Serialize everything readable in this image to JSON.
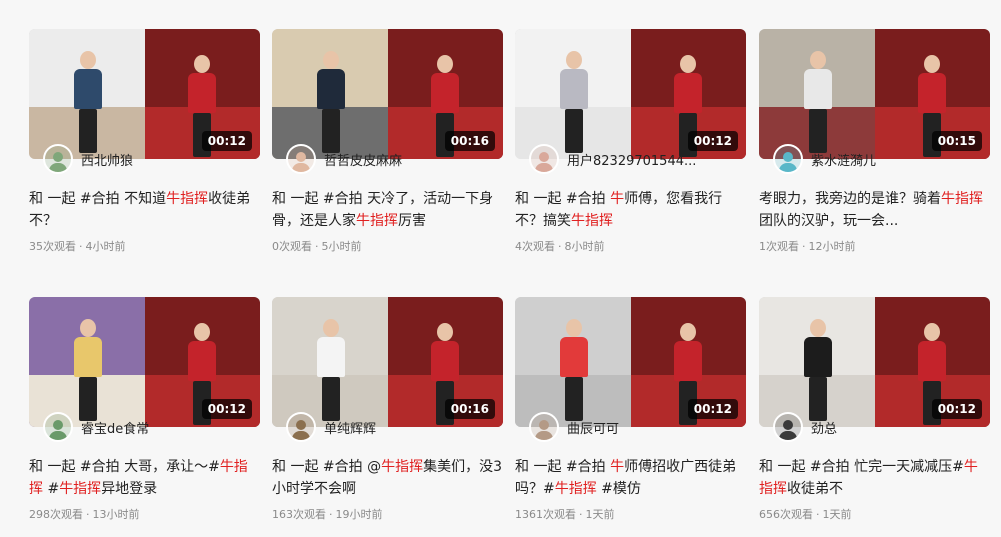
{
  "videos": [
    {
      "duration": "00:12",
      "author": "西北帅狼",
      "title_parts": [
        "和 一起 #合拍 不知道",
        "牛指挥",
        "收徒弟不？"
      ],
      "views": "35次观看",
      "time": "4小时前",
      "colors": {
        "left_bg": "#ececec",
        "left_floor": "#c9b7a2",
        "shirt": "#2e4a6b",
        "avatar": "#7fa77a"
      }
    },
    {
      "duration": "00:16",
      "author": "哲哲皮皮麻麻",
      "title_parts": [
        "和 一起 #合拍 天冷了，活动一下身骨，还是人家",
        "牛指挥",
        "厉害"
      ],
      "views": "0次观看",
      "time": "5小时前",
      "colors": {
        "left_bg": "#d9cbb0",
        "left_floor": "#6e6e6e",
        "shirt": "#1f2a3a",
        "avatar": "#e0b8a0"
      }
    },
    {
      "duration": "00:12",
      "author": "用户82329701544...",
      "title_parts": [
        "和 一起 #合拍 ",
        "牛",
        "师傅，您看我行不？搞笑",
        "牛指挥",
        ""
      ],
      "views": "4次观看",
      "time": "8小时前",
      "colors": {
        "left_bg": "#f2f2f2",
        "left_floor": "#e6e6e6",
        "shirt": "#b9b9c2",
        "avatar": "#d9a89a"
      }
    },
    {
      "duration": "00:15",
      "author": "紫水涟漪儿",
      "title_parts": [
        "考眼力，我旁边的是谁？骑着",
        "牛指挥",
        "团队的汉驴，玩一会..."
      ],
      "views": "1次观看",
      "time": "12小时前",
      "colors": {
        "left_bg": "#b9b2a6",
        "left_floor": "#8d3a3a",
        "shirt": "#e8e8e8",
        "avatar": "#59b7c8"
      }
    },
    {
      "duration": "00:12",
      "author": "睿宝de食常",
      "title_parts": [
        "和 一起 #合拍 大哥，承让～#",
        "牛指挥",
        " #",
        "牛指挥",
        "异地登录"
      ],
      "views": "298次观看",
      "time": "13小时前",
      "colors": {
        "left_bg": "#8a6fa8",
        "left_floor": "#e9e2d6",
        "shirt": "#e8c76b",
        "avatar": "#6a9a6a"
      }
    },
    {
      "duration": "00:16",
      "author": "单纯辉辉",
      "title_parts": [
        "和 一起 #合拍 @",
        "牛指挥",
        "集美们，没3小时学不会啊"
      ],
      "views": "163次观看",
      "time": "19小时前",
      "colors": {
        "left_bg": "#d8d4cc",
        "left_floor": "#cfc9bf",
        "shirt": "#f4f4f4",
        "avatar": "#8b6f4e"
      }
    },
    {
      "duration": "00:12",
      "author": "曲辰可可",
      "title_parts": [
        "和 一起 #合拍 ",
        "牛",
        "师傅招收广西徒弟吗？#",
        "牛指挥",
        " #模仿"
      ],
      "views": "1361次观看",
      "time": "1天前",
      "colors": {
        "left_bg": "#cfcfcf",
        "left_floor": "#bdbdbd",
        "shirt": "#e23a3a",
        "avatar": "#b49a86"
      }
    },
    {
      "duration": "00:12",
      "author": "劲总",
      "title_parts": [
        "和 一起 #合拍 忙完一天减减压#",
        "牛指挥",
        "收徒弟不"
      ],
      "views": "656次观看",
      "time": "1天前",
      "colors": {
        "left_bg": "#e8e6e2",
        "left_floor": "#d6d2cc",
        "shirt": "#1c1c1c",
        "avatar": "#3a3a3a"
      }
    }
  ],
  "shared_right_video": {
    "bg": "#7a1d1d",
    "floor": "#b22a2a",
    "performer_shirt": "#c4232b"
  }
}
